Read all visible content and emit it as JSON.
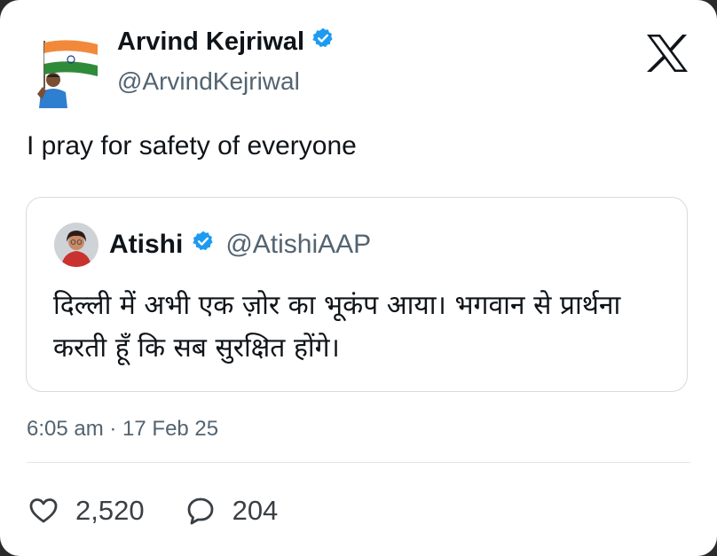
{
  "author": {
    "name": "Arvind Kejriwal",
    "handle": "@ArvindKejriwal"
  },
  "tweet": {
    "text": "I pray for safety of everyone",
    "timestamp": "6:05 am · 17 Feb 25"
  },
  "quoted": {
    "name": "Atishi",
    "handle": "@AtishiAAP",
    "text": "दिल्ली में अभी एक ज़ोर का भूकंप आया। भगवान से प्रार्थना करती हूँ कि सब सुरक्षित होंगे।"
  },
  "stats": {
    "likes": "2,520",
    "replies": "204"
  },
  "icons": {
    "verified": "verified-badge-icon",
    "logo": "x-logo-icon",
    "like": "heart-icon",
    "reply": "speech-bubble-icon"
  },
  "colors": {
    "verified": "#1d9bf0",
    "text": "#0f1419",
    "secondary": "#536471"
  }
}
